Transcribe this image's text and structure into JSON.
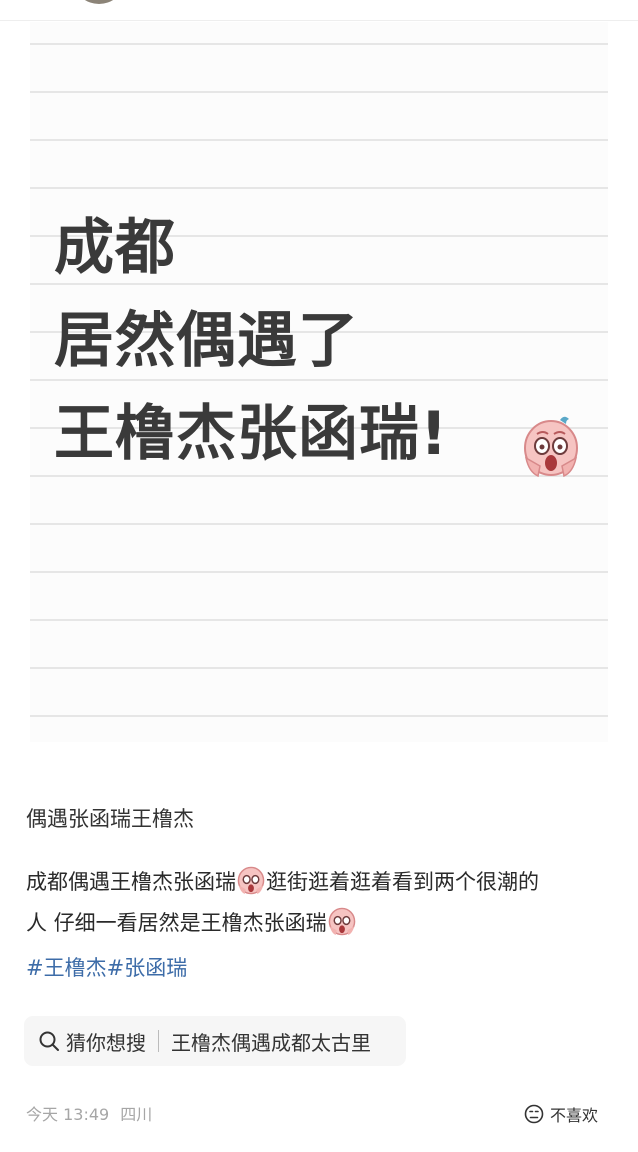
{
  "cover": {
    "line1": "成都",
    "line2": "居然偶遇了",
    "line3": "王橹杰张函瑞!",
    "emoji": "scream-emoji"
  },
  "post": {
    "title": "偶遇张函瑞王橹杰",
    "body_line1_a": "成都偶遇王橹杰张函瑞",
    "body_line1_b": "逛街逛着逛着看到两个很潮的",
    "body_line2": "人 仔细一看居然是王橹杰张函瑞",
    "hashtags": [
      "#王橹杰",
      "#张函瑞"
    ]
  },
  "search_chip": {
    "icon": "search-icon",
    "label": "猜你想搜",
    "query": "王橹杰偶遇成都太古里"
  },
  "meta": {
    "date": "今天 13:49",
    "location": "四川"
  },
  "actions": {
    "dislike_label": "不喜欢",
    "dislike_icon": "frown-face-icon"
  },
  "colors": {
    "hashtag": "#3d6ca8",
    "cover_text": "#3a3a3a",
    "meta": "#a6a6a6"
  }
}
